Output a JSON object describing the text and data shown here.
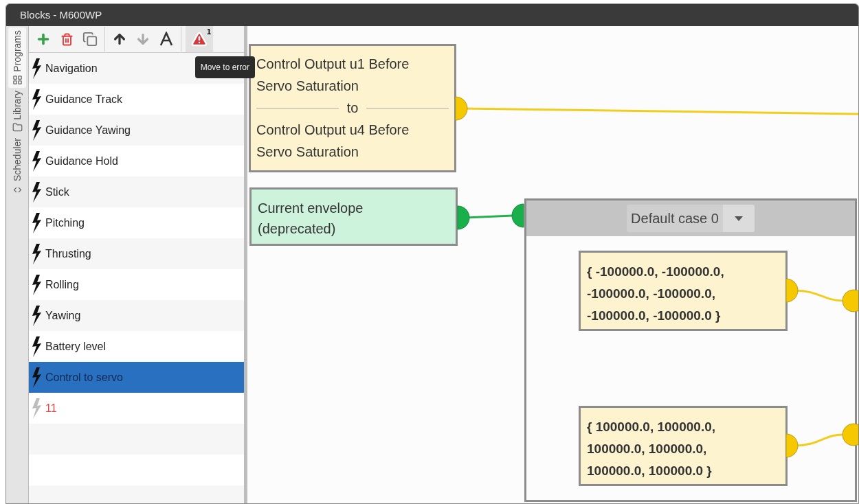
{
  "window": {
    "title": "Blocks - M600WP"
  },
  "side_tabs": [
    {
      "label": "Programs",
      "selected": true
    },
    {
      "label": "Library",
      "selected": false
    },
    {
      "label": "Scheduler",
      "selected": false
    }
  ],
  "toolbar": {
    "error_count": "1",
    "tooltip": "Move to error"
  },
  "programs": [
    {
      "label": "Navigation",
      "selected": false,
      "invalid": false
    },
    {
      "label": "Guidance Track",
      "selected": false,
      "invalid": false
    },
    {
      "label": "Guidance Yawing",
      "selected": false,
      "invalid": false
    },
    {
      "label": "Guidance Hold",
      "selected": false,
      "invalid": false
    },
    {
      "label": "Stick",
      "selected": false,
      "invalid": false
    },
    {
      "label": "Pitching",
      "selected": false,
      "invalid": false
    },
    {
      "label": "Thrusting",
      "selected": false,
      "invalid": false
    },
    {
      "label": "Rolling",
      "selected": false,
      "invalid": false
    },
    {
      "label": "Yawing",
      "selected": false,
      "invalid": false
    },
    {
      "label": "Battery level",
      "selected": false,
      "invalid": false
    },
    {
      "label": "Control to servo",
      "selected": true,
      "invalid": false
    },
    {
      "label": "11",
      "selected": false,
      "invalid": true
    }
  ],
  "canvas": {
    "range_block": {
      "from": "Control Output u1 Before Servo Saturation",
      "separator": "to",
      "to": "Control Output u4 Before Servo Saturation"
    },
    "variable_block": {
      "text": "Current envelope (deprecated)"
    },
    "switch_block": {
      "case_select": "Default case 0",
      "constants": [
        "{ -100000.0, -100000.0, -100000.0, -100000.0, -100000.0, -100000.0 }",
        "{ 100000.0, 100000.0, 100000.0, 100000.0, 100000.0, 100000.0 }"
      ]
    }
  }
}
